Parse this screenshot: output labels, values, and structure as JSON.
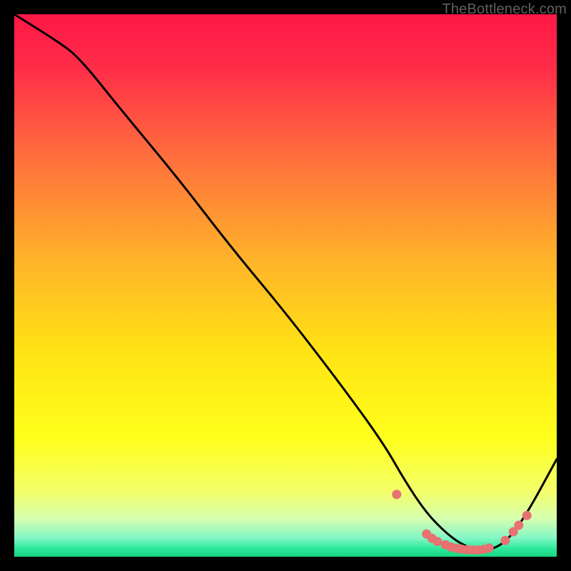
{
  "attribution": "TheBottleneck.com",
  "colors": {
    "dot": "#e87171",
    "lineStroke": "#000000",
    "gradStops": [
      {
        "offset": 0.0,
        "color": "#ff1846"
      },
      {
        "offset": 0.1,
        "color": "#ff2d48"
      },
      {
        "offset": 0.25,
        "color": "#ff6a3e"
      },
      {
        "offset": 0.45,
        "color": "#ffb22a"
      },
      {
        "offset": 0.62,
        "color": "#ffe314"
      },
      {
        "offset": 0.78,
        "color": "#ffff1c"
      },
      {
        "offset": 0.88,
        "color": "#f3ff6a"
      },
      {
        "offset": 0.93,
        "color": "#d6ffb0"
      },
      {
        "offset": 0.965,
        "color": "#84f7c6"
      },
      {
        "offset": 0.985,
        "color": "#2de89a"
      },
      {
        "offset": 1.0,
        "color": "#18d680"
      }
    ]
  },
  "chart_data": {
    "type": "line",
    "title": "",
    "xlabel": "",
    "ylabel": "",
    "xlim": [
      0,
      100
    ],
    "ylim": [
      0,
      100
    ],
    "x": [
      0,
      8,
      12,
      20,
      30,
      40,
      50,
      60,
      68,
      72,
      76,
      80,
      83,
      86,
      90,
      94,
      100
    ],
    "y": [
      100,
      95,
      92,
      82,
      70,
      57,
      45,
      32,
      21,
      14,
      8,
      4,
      2,
      1,
      2,
      7,
      18
    ],
    "annotations": [],
    "dots_x": [
      70.5,
      76,
      77,
      78,
      79.5,
      80.5,
      81.5,
      82.5,
      83.5,
      84.5,
      85.5,
      86.5,
      87.5,
      90.5,
      92,
      93,
      94.5
    ],
    "dots_y": [
      11.5,
      4.2,
      3.4,
      2.8,
      2.2,
      1.8,
      1.55,
      1.4,
      1.3,
      1.25,
      1.25,
      1.35,
      1.6,
      3.0,
      4.6,
      5.8,
      7.6
    ]
  }
}
